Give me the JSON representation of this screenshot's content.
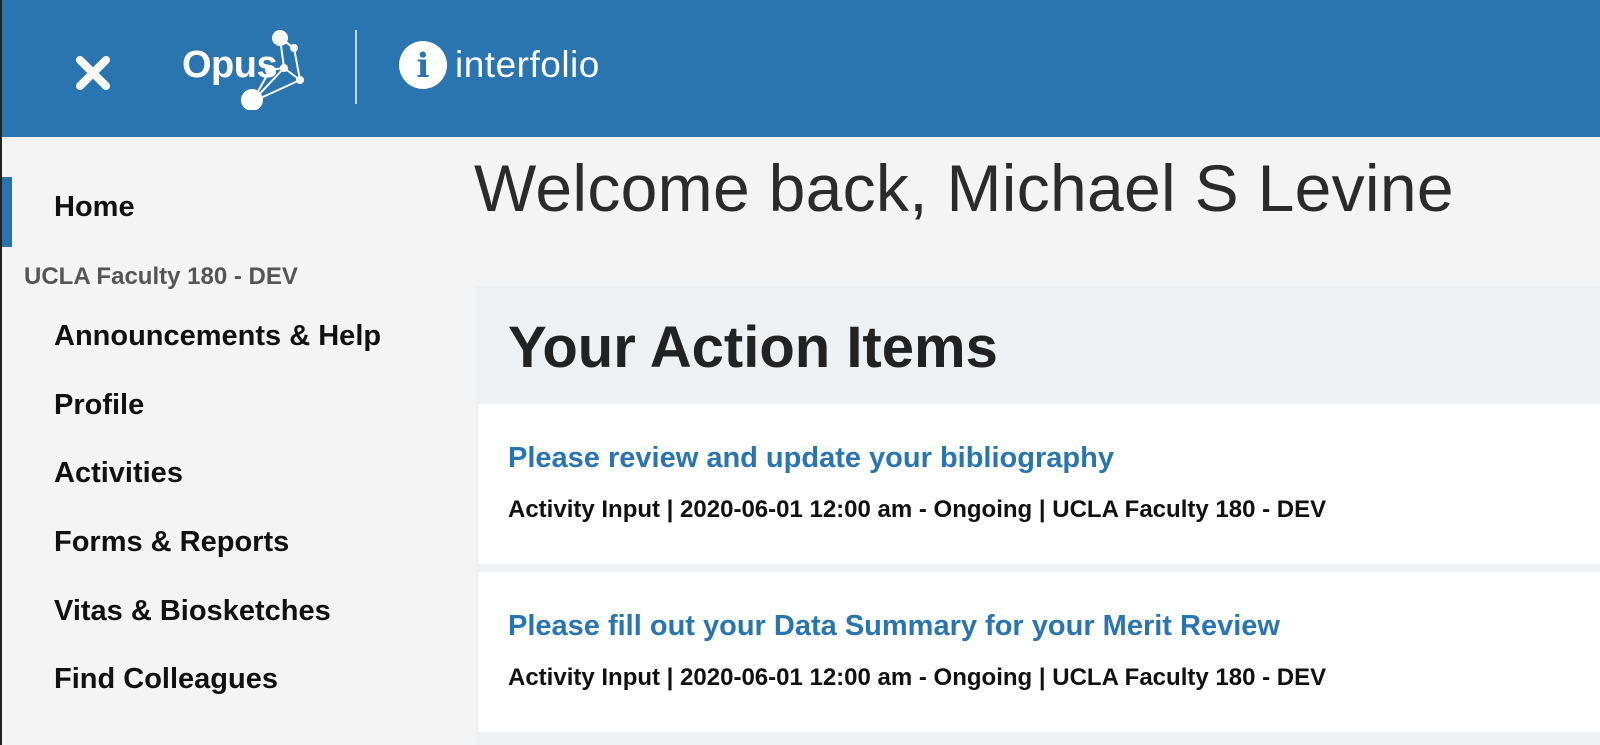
{
  "header": {
    "close_icon": "close-icon",
    "opus_logo_text": "Opus",
    "interfolio_logo_letter": "i",
    "interfolio_logo_text": "interfolio",
    "background_color": "#2a74b0"
  },
  "sidebar": {
    "home_label": "Home",
    "section_label": "UCLA Faculty 180 - DEV",
    "items": [
      {
        "label": "Announcements & Help"
      },
      {
        "label": "Profile"
      },
      {
        "label": "Activities"
      },
      {
        "label": "Forms & Reports"
      },
      {
        "label": "Vitas & Biosketches"
      },
      {
        "label": "Find Colleagues"
      }
    ]
  },
  "main": {
    "welcome": "Welcome back, Michael S Levine",
    "action_items_title": "Your Action Items",
    "action_items": [
      {
        "title": "Please review and update your bibliography",
        "meta": "Activity Input | 2020-06-01 12:00 am - Ongoing | UCLA Faculty 180 - DEV"
      },
      {
        "title": "Please fill out your Data Summary for your Merit Review",
        "meta": "Activity Input | 2020-06-01 12:00 am - Ongoing | UCLA Faculty 180 - DEV"
      }
    ]
  },
  "colors": {
    "accent": "#2a74b0",
    "link": "#2a74b0",
    "sidebar_bg": "#f4f4f4",
    "panel_bg": "#eef1f4"
  }
}
